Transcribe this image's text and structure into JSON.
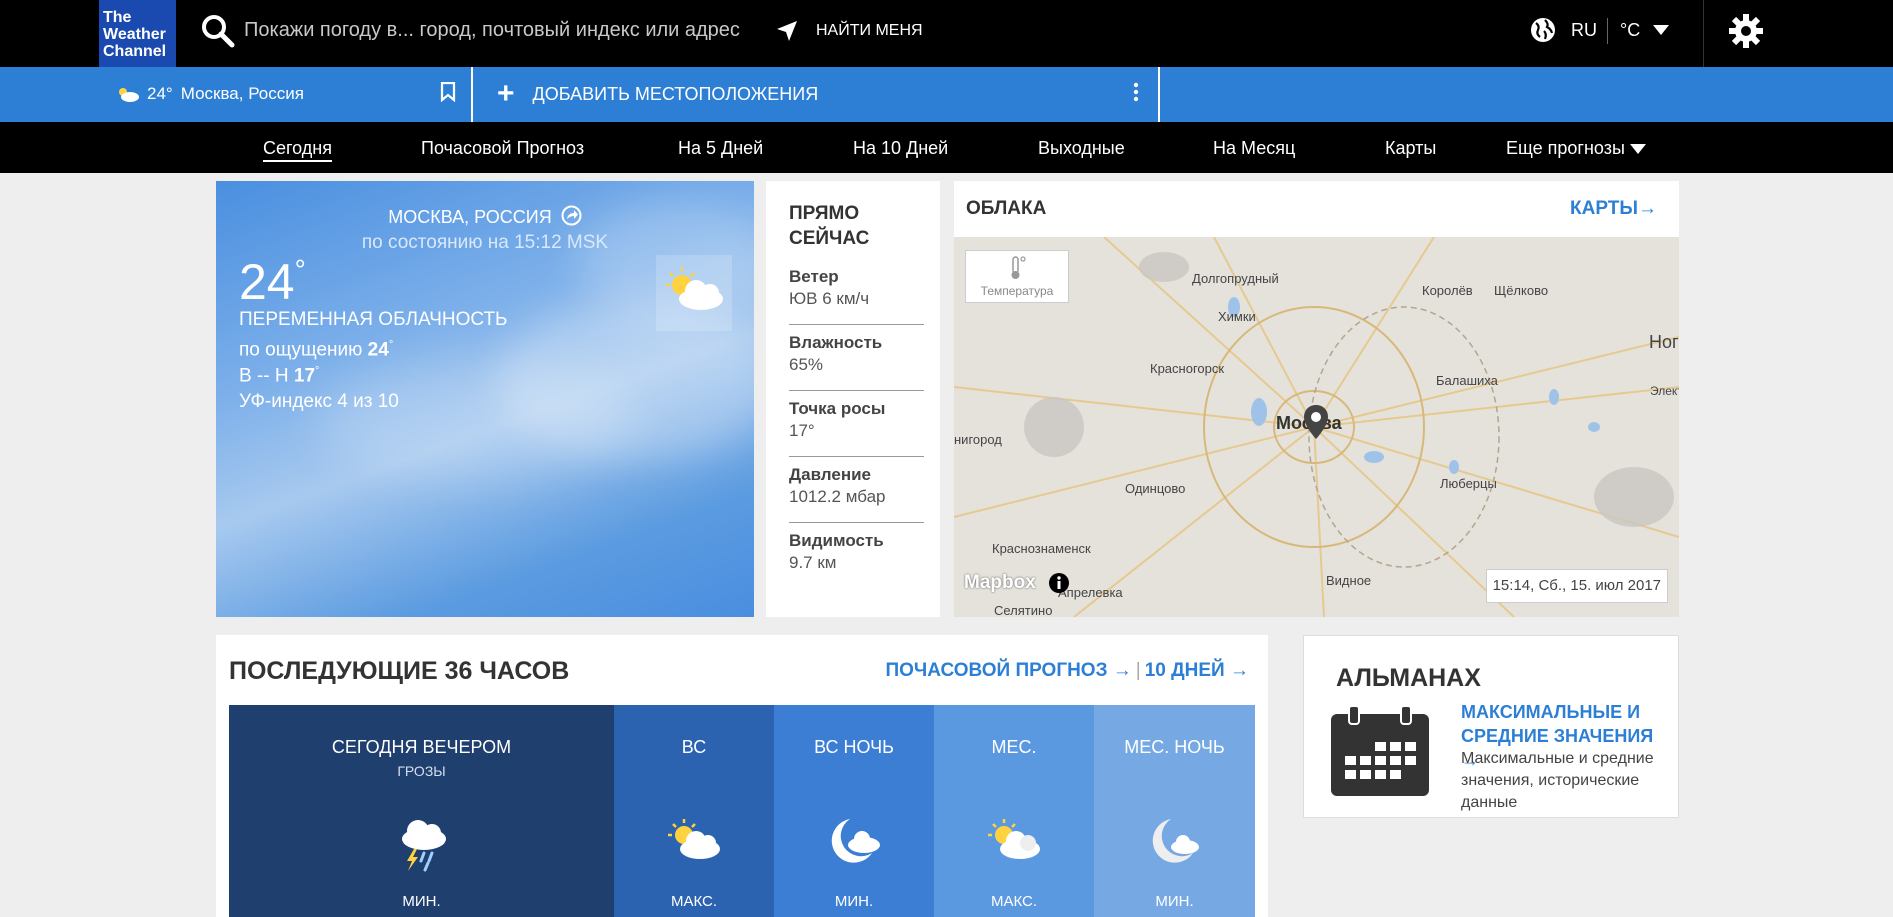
{
  "header": {
    "logo_lines": [
      "The",
      "Weather",
      "Channel"
    ],
    "search_placeholder": "Покажи погоду в... город, почтовый индекс или адрес",
    "find_me": "НАЙТИ МЕНЯ",
    "language": "RU",
    "unit": "°C"
  },
  "location_bar": {
    "saved_temp": "24°",
    "saved_city": "Москва, Россия",
    "add_location": "ДОБАВИТЬ МЕСТОПОЛОЖЕНИЯ"
  },
  "nav": {
    "items": [
      "Сегодня",
      "Почасовой Прогноз",
      "На 5 Дней",
      "На 10 Дней",
      "Выходные",
      "На Месяц",
      "Карты",
      "Еще прогнозы"
    ],
    "active": "Сегодня"
  },
  "current": {
    "city": "МОСКВА, РОССИЯ",
    "as_of": "по состоянию на 15:12 MSK",
    "temp": "24",
    "deg": "°",
    "condition": "ПЕРЕМЕННАЯ ОБЛАЧНОСТЬ",
    "feels_like_label": "по ощущению",
    "feels_like_value": "24",
    "hi_lo_label": "В -- Н",
    "low_value": "17",
    "uv": "УФ-индекс 4 из 10"
  },
  "right_now": {
    "title": "ПРЯМО СЕЙЧАС",
    "items": [
      {
        "label": "Ветер",
        "value": "ЮВ 6 км/ч"
      },
      {
        "label": "Влажность",
        "value": "65%"
      },
      {
        "label": "Точка росы",
        "value": "17°"
      },
      {
        "label": "Давление",
        "value": "1012.2 мбар"
      },
      {
        "label": "Видимость",
        "value": "9.7 км"
      }
    ]
  },
  "map": {
    "title": "ОБЛАКА",
    "link": "КАРТЫ",
    "layer_label": "Температура",
    "timestamp": "15:14, Сб., 15. июл 2017",
    "attribution": "Mapbox",
    "places": [
      "Долгопрудный",
      "Королёв",
      "Щёлково",
      "Химки",
      "Ног",
      "Красногорск",
      "Балашиха",
      "Элект",
      "Москва",
      "нигород",
      "Одинцово",
      "Люберцы",
      "Краснознаменск",
      "Видное",
      "Апрелевка",
      "Селятино"
    ]
  },
  "hours36": {
    "title": "ПОСЛЕДУЮЩИЕ 36 ЧАСОВ",
    "link_hourly": "ПОЧАСОВОЙ ПРОГНОЗ",
    "link_10days": "10 ДНЕЙ",
    "columns": [
      {
        "name": "СЕГОДНЯ ВЕЧЕРОМ",
        "sub": "ГРОЗЫ",
        "label": "МИН.",
        "icon": "thunderstorm-icon",
        "color": "#1f3f6e"
      },
      {
        "name": "ВС",
        "sub": "",
        "label": "МАКС.",
        "icon": "partly-sunny-icon",
        "color": "#2b63b0"
      },
      {
        "name": "ВС НОЧЬ",
        "sub": "",
        "label": "МИН.",
        "icon": "partly-cloudy-night-icon",
        "color": "#3b7ed4"
      },
      {
        "name": "МЕС.",
        "sub": "",
        "label": "МАКС.",
        "icon": "partly-sunny-icon",
        "color": "#5a98e0"
      },
      {
        "name": "МЕС. НОЧЬ",
        "sub": "",
        "label": "МИН.",
        "icon": "partly-cloudy-night-icon",
        "color": "#76a9e4"
      }
    ]
  },
  "almanac": {
    "title": "АЛЬМАНАХ",
    "link": "МАКСИМАЛЬНЫЕ И СРЕДНИЕ ЗНАЧЕНИЯ",
    "desc": "Максимальные и средние значения, исторические данные"
  }
}
